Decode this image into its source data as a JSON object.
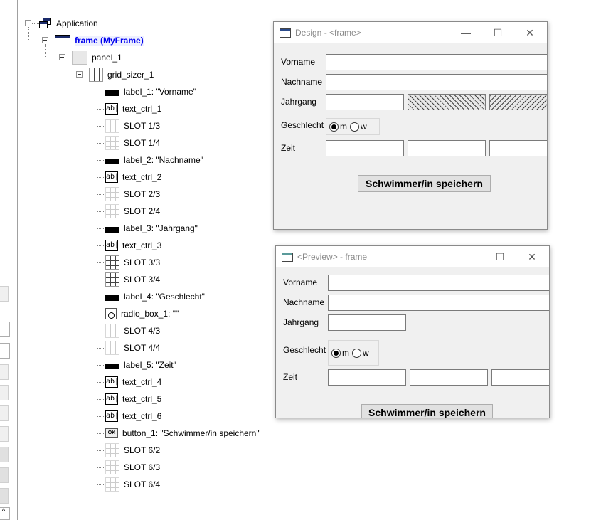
{
  "tree": {
    "nodes": [
      {
        "label": "Application",
        "icon": "app"
      },
      {
        "label": "frame (MyFrame)",
        "icon": "frame"
      },
      {
        "label": "panel_1",
        "icon": "panel"
      },
      {
        "label": "grid_sizer_1",
        "icon": "grid"
      },
      {
        "label": "label_1: \"Vorname\"",
        "icon": "label"
      },
      {
        "label": "text_ctrl_1",
        "icon": "text"
      },
      {
        "label": "SLOT 1/3",
        "icon": "slot"
      },
      {
        "label": "SLOT 1/4",
        "icon": "slot"
      },
      {
        "label": "label_2: \"Nachname\"",
        "icon": "label"
      },
      {
        "label": "text_ctrl_2",
        "icon": "text"
      },
      {
        "label": "SLOT 2/3",
        "icon": "slot"
      },
      {
        "label": "SLOT 2/4",
        "icon": "slot"
      },
      {
        "label": "label_3: \"Jahrgang\"",
        "icon": "label"
      },
      {
        "label": "text_ctrl_3",
        "icon": "text"
      },
      {
        "label": "SLOT 3/3",
        "icon": "slot-dark"
      },
      {
        "label": "SLOT 3/4",
        "icon": "slot-dark"
      },
      {
        "label": "label_4: \"Geschlecht\"",
        "icon": "label"
      },
      {
        "label": "radio_box_1: \"\"",
        "icon": "radio"
      },
      {
        "label": "SLOT 4/3",
        "icon": "slot"
      },
      {
        "label": "SLOT 4/4",
        "icon": "slot"
      },
      {
        "label": "label_5: \"Zeit\"",
        "icon": "label"
      },
      {
        "label": "text_ctrl_4",
        "icon": "text"
      },
      {
        "label": "text_ctrl_5",
        "icon": "text"
      },
      {
        "label": "text_ctrl_6",
        "icon": "text"
      },
      {
        "label": "button_1: \"Schwimmer/in speichern\"",
        "icon": "button"
      },
      {
        "label": "SLOT 6/2",
        "icon": "slot"
      },
      {
        "label": "SLOT 6/3",
        "icon": "slot"
      },
      {
        "label": "SLOT 6/4",
        "icon": "slot"
      }
    ],
    "button_icon_text": "OK",
    "text_icon_text": "ab|"
  },
  "design_window": {
    "title": "Design - <frame>",
    "labels": {
      "vorname": "Vorname",
      "nachname": "Nachname",
      "jahrgang": "Jahrgang",
      "geschlecht": "Geschlecht",
      "zeit": "Zeit"
    },
    "radio": {
      "m": "m",
      "w": "w"
    },
    "button": "Schwimmer/in speichern"
  },
  "preview_window": {
    "title": "<Preview> - frame",
    "labels": {
      "vorname": "Vorname",
      "nachname": "Nachname",
      "jahrgang": "Jahrgang",
      "geschlecht": "Geschlecht",
      "zeit": "Zeit"
    },
    "radio": {
      "m": "m",
      "w": "w"
    },
    "button": "Schwimmer/in speichern"
  },
  "window_controls": {
    "minimize": "—",
    "maximize": "☐",
    "close": "✕"
  }
}
